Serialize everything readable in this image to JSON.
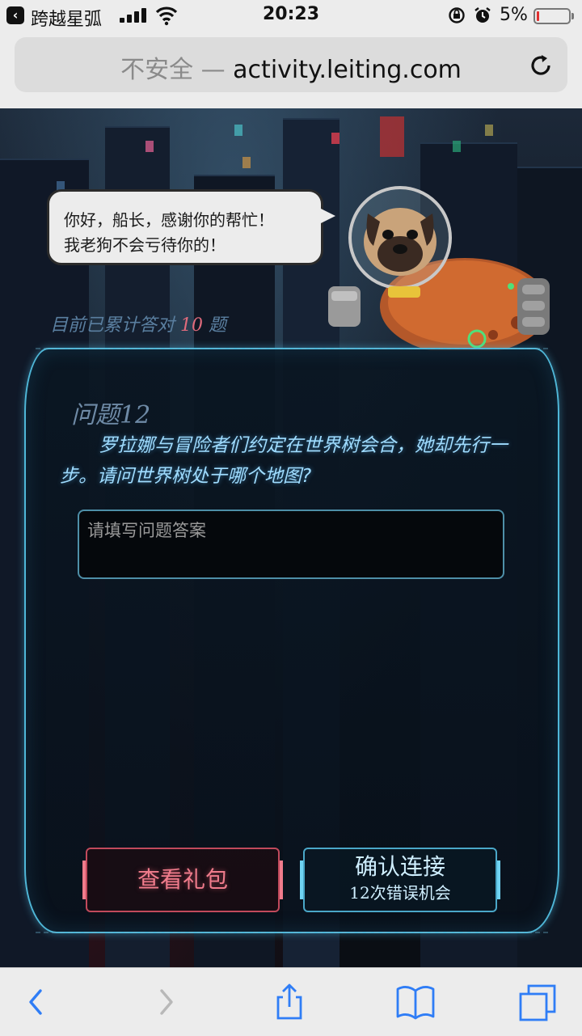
{
  "status_bar": {
    "back_app": "跨越星弧",
    "time": "20:23",
    "battery_percent": "5%",
    "battery_level": 0.05,
    "icons": [
      "back-icon",
      "signal-icon",
      "wifi-icon",
      "orientation-lock-icon",
      "alarm-icon",
      "battery-icon"
    ]
  },
  "browser": {
    "insecure_label": "不安全 —",
    "url": "activity.leiting.com",
    "reload_icon": "reload-icon",
    "toolbar_icons": [
      "back-arrow-icon",
      "forward-arrow-icon",
      "share-icon",
      "bookmarks-icon",
      "tabs-icon"
    ]
  },
  "game": {
    "speech": {
      "line1": "你好，船长，感谢你的帮忙！",
      "line2": "我老狗不会亏待你的！"
    },
    "progress": {
      "prefix": "目前已累计答对",
      "count": "10",
      "suffix": "题"
    },
    "question": {
      "title": "问题12",
      "text": "罗拉娜与冒险者们约定在世界树会合，她却先行一步。请问世界树处于哪个地图?"
    },
    "answer": {
      "placeholder": "请填写问题答案",
      "value": ""
    },
    "buttons": {
      "gift_label": "查看礼包",
      "confirm_label": "确认连接",
      "confirm_sub": "12次错误机会"
    },
    "colors": {
      "accent_cyan": "#4fb7d8",
      "accent_pink": "#f07c8c",
      "question_text": "#9fdcff"
    }
  }
}
